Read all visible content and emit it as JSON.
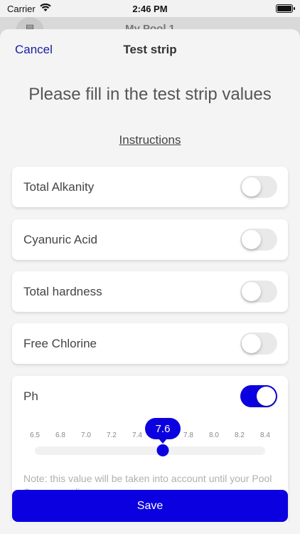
{
  "status_bar": {
    "carrier": "Carrier",
    "time": "2:46 PM"
  },
  "background_screen": {
    "title": "My Pool 1"
  },
  "nav": {
    "cancel_label": "Cancel",
    "title": "Test strip"
  },
  "heading": "Please fill in the test strip values",
  "instructions_label": "Instructions",
  "parameters": [
    {
      "label": "Total Alkanity",
      "enabled": false
    },
    {
      "label": "Cyanuric Acid",
      "enabled": false
    },
    {
      "label": "Total hardness",
      "enabled": false
    },
    {
      "label": "Free Chlorine",
      "enabled": false
    }
  ],
  "ph": {
    "label": "Ph",
    "enabled": true,
    "value": "7.6",
    "min": 6.4,
    "max": 8.5,
    "ticks": [
      "6.5",
      "6.8",
      "7.0",
      "7.2",
      "7.4",
      "7.6",
      "7.8",
      "8.0",
      "8.2",
      "8.4"
    ],
    "note": "Note: this value will be taken into account until your Pool Sensor reading"
  },
  "save_label": "Save",
  "colors": {
    "accent": "#0b00e0",
    "cancel": "#1a1aa6"
  }
}
